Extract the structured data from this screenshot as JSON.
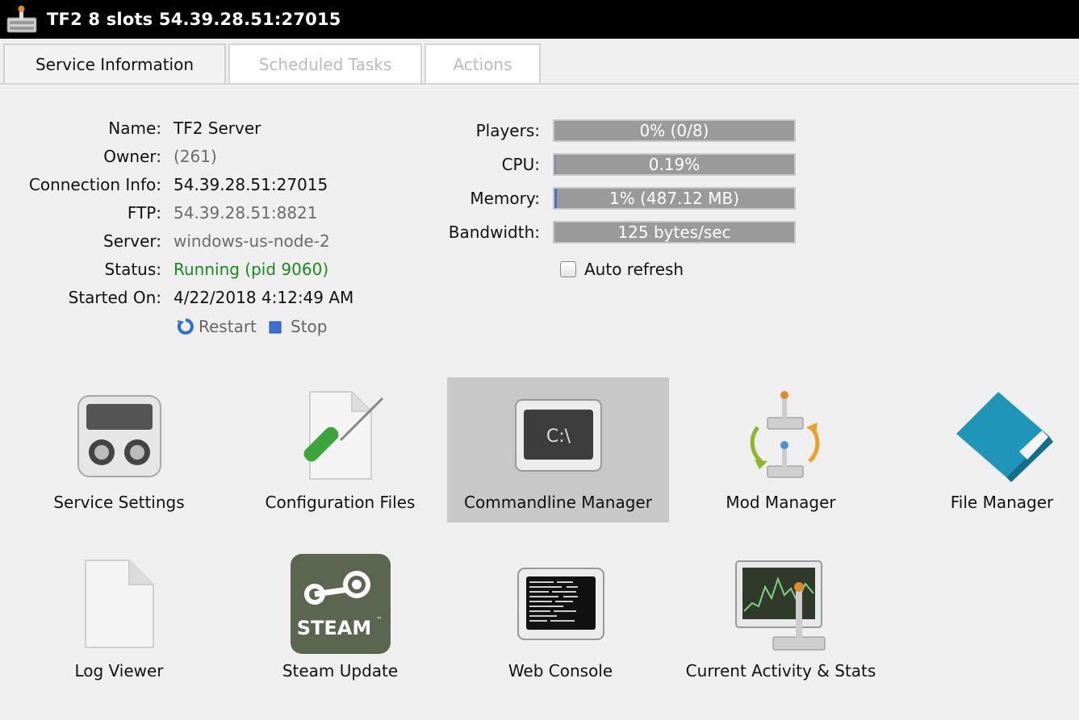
{
  "window": {
    "title": "TF2 8 slots 54.39.28.51:27015"
  },
  "tabs": [
    {
      "label": "Service Information",
      "active": true
    },
    {
      "label": "Scheduled Tasks",
      "active": false
    },
    {
      "label": "Actions",
      "active": false
    }
  ],
  "info": {
    "name_label": "Name:",
    "name": "TF2 Server",
    "owner_label": "Owner:",
    "owner": "(261)",
    "connection_label": "Connection Info:",
    "connection": "54.39.28.51:27015",
    "ftp_label": "FTP:",
    "ftp": "54.39.28.51:8821",
    "server_label": "Server:",
    "server": "windows-us-node-2",
    "status_label": "Status:",
    "status": "Running (pid 9060)",
    "started_label": "Started On:",
    "started": "4/22/2018 4:12:49 AM"
  },
  "actions": {
    "restart": "Restart",
    "stop": "Stop"
  },
  "meters": {
    "players": {
      "label": "Players:",
      "text": "0% (0/8)",
      "percent": 0
    },
    "cpu": {
      "label": "CPU:",
      "text": "0.19%",
      "percent": 0.19
    },
    "memory": {
      "label": "Memory:",
      "text": "1% (487.12 MB)",
      "percent": 1
    },
    "bandwidth": {
      "label": "Bandwidth:",
      "text": "125 bytes/sec",
      "percent": 0
    }
  },
  "auto_refresh": {
    "label": "Auto refresh",
    "checked": false
  },
  "tiles": [
    {
      "label": "Service Settings",
      "icon": "service-settings-icon"
    },
    {
      "label": "Configuration Files",
      "icon": "config-files-icon"
    },
    {
      "label": "Commandline Manager",
      "icon": "commandline-icon",
      "selected": true
    },
    {
      "label": "Mod Manager",
      "icon": "mod-manager-icon"
    },
    {
      "label": "File Manager",
      "icon": "file-manager-icon"
    },
    {
      "label": "Log Viewer",
      "icon": "log-viewer-icon"
    },
    {
      "label": "Steam Update",
      "icon": "steam-icon"
    },
    {
      "label": "Web Console",
      "icon": "web-console-icon"
    },
    {
      "label": "Current Activity & Stats",
      "icon": "activity-stats-icon"
    }
  ],
  "icon_text": {
    "cmd_prompt": "C:\\",
    "steam_word": "STEAM",
    "steam_tm": "™"
  },
  "colors": {
    "status_running": "#1a8a1a",
    "meter_fill": "#4a6fc7",
    "titlebar": "#000000"
  }
}
